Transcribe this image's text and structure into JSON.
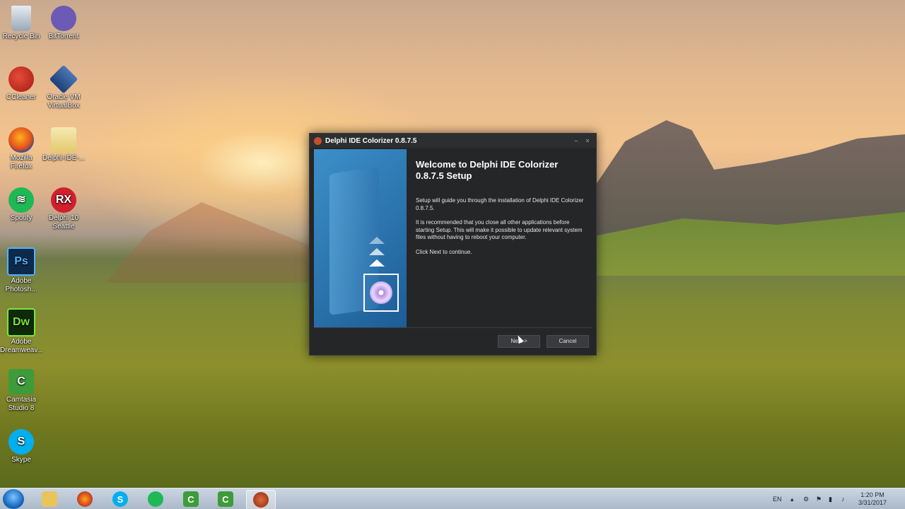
{
  "desktop_icons": [
    {
      "label": "Recycle Bin",
      "icon": "recycle-bin-icon"
    },
    {
      "label": "BitTorrent",
      "icon": "bittorrent-icon"
    },
    {
      "label": "CCleaner",
      "icon": "ccleaner-icon"
    },
    {
      "label": "Oracle VM VirtualBox",
      "icon": "virtualbox-icon"
    },
    {
      "label": "Mozilla Firefox",
      "icon": "firefox-icon"
    },
    {
      "label": "Delphi-IDE-...",
      "icon": "folder-icon"
    },
    {
      "label": "Spotify",
      "icon": "spotify-icon"
    },
    {
      "label": "Delphi 10 Seattle",
      "icon": "delphi-rx-icon",
      "glyph": "RX"
    },
    {
      "label": "Adobe Photosh...",
      "icon": "photoshop-icon",
      "glyph": "Ps"
    },
    {
      "label": "Adobe Dreamweav...",
      "icon": "dreamweaver-icon",
      "glyph": "Dw"
    },
    {
      "label": "Camtasia Studio 8",
      "icon": "camtasia-icon",
      "glyph": "C"
    },
    {
      "label": "Skype",
      "icon": "skype-icon",
      "glyph": "S"
    }
  ],
  "installer": {
    "title": "Delphi IDE Colorizer 0.8.7.5",
    "heading": "Welcome to Delphi IDE Colorizer 0.8.7.5 Setup",
    "para1": "Setup will guide you through the installation of Delphi IDE Colorizer 0.8.7.5.",
    "para2": "It is recommended that you close all other applications before starting Setup. This will make it possible to update relevant system files without having to reboot your computer.",
    "para3": "Click Next to continue.",
    "next_label": "Next >",
    "cancel_label": "Cancel"
  },
  "taskbar": {
    "items": [
      {
        "name": "explorer",
        "icon": "folder-icon"
      },
      {
        "name": "firefox",
        "icon": "firefox-icon"
      },
      {
        "name": "skype",
        "icon": "skype-icon",
        "glyph": "S"
      },
      {
        "name": "spotify",
        "icon": "spotify-icon"
      },
      {
        "name": "camtasia-recorder",
        "icon": "camtasia-icon",
        "glyph": "C"
      },
      {
        "name": "camtasia-studio",
        "icon": "camtasia-icon",
        "glyph": "C"
      },
      {
        "name": "delphi-installer",
        "icon": "delphi-icon"
      }
    ],
    "language": "EN",
    "time": "1:20 PM",
    "date": "3/31/2017"
  },
  "colors": {
    "taskbar": "#aab8c8",
    "window_bg": "#252628",
    "hero_blue": "#2f75b0"
  }
}
